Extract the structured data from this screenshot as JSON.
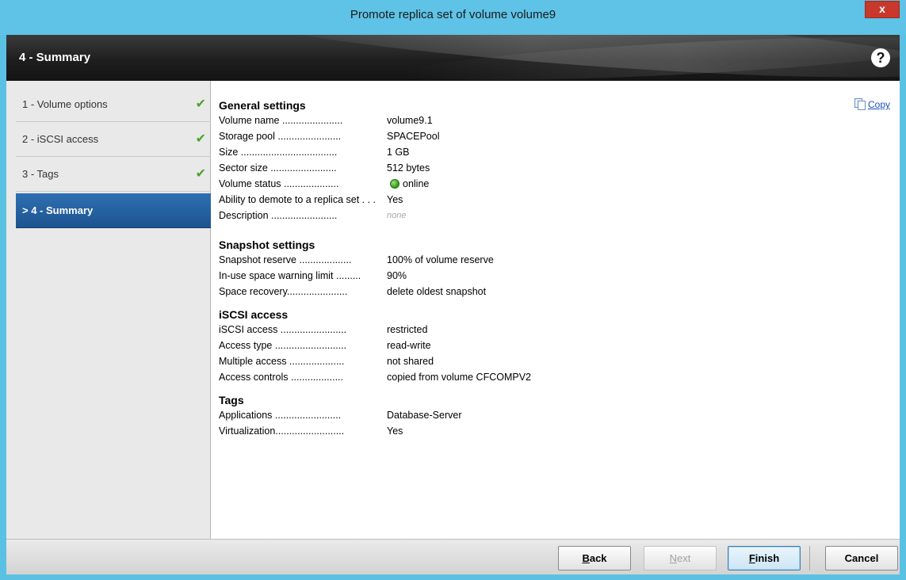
{
  "window": {
    "title": "Promote replica set of volume volume9",
    "close_label": "x"
  },
  "header": {
    "title": "4 - Summary",
    "help_label": "?"
  },
  "nav": {
    "items": [
      {
        "label": "1 - Volume options",
        "done": true
      },
      {
        "label": "2 - iSCSI access",
        "done": true
      },
      {
        "label": "3 - Tags",
        "done": true
      },
      {
        "label": "> 4 - Summary",
        "done": false
      }
    ],
    "check_glyph": "✔"
  },
  "content": {
    "copy_label": "Copy",
    "general": {
      "title": "General settings",
      "rows": [
        {
          "label": "Volume name ......................",
          "value": "volume9.1"
        },
        {
          "label": "Storage pool .......................",
          "value": "SPACEPool"
        },
        {
          "label": "Size ...................................",
          "value": "1 GB"
        },
        {
          "label": "Sector size ........................",
          "value": "512 bytes"
        },
        {
          "label": "Volume status ....................",
          "value": "online"
        },
        {
          "label": "Ability to demote to a replica set . . .",
          "value": "Yes"
        },
        {
          "label": "Description ........................",
          "value": "none"
        }
      ]
    },
    "snapshot": {
      "title": "Snapshot settings",
      "rows": [
        {
          "label": "Snapshot reserve ...................",
          "value": "100% of volume reserve"
        },
        {
          "label": "In-use space warning limit .........",
          "value": "90%"
        },
        {
          "label": "Space recovery......................",
          "value": "delete oldest snapshot"
        }
      ]
    },
    "iscsi": {
      "title": "iSCSI access",
      "rows": [
        {
          "label": "iSCSI access ........................",
          "value": "restricted"
        },
        {
          "label": "Access type ..........................",
          "value": "read-write"
        },
        {
          "label": "Multiple access ....................",
          "value": "not shared"
        },
        {
          "label": "Access controls ...................",
          "value": "copied from volume CFCOMPV2"
        }
      ]
    },
    "tags": {
      "title": "Tags",
      "rows": [
        {
          "label": "Applications ........................",
          "value": "Database-Server"
        },
        {
          "label": "Virtualization.........................",
          "value": "Yes"
        }
      ]
    }
  },
  "footer": {
    "back": {
      "label": "Back",
      "mnemonic": "B",
      "rest": "ack"
    },
    "next": {
      "label": "Next",
      "mnemonic": "N",
      "rest": "ext"
    },
    "finish": {
      "label": "Finish",
      "mnemonic": "F",
      "rest": "inish"
    },
    "cancel": {
      "label": "Cancel"
    }
  },
  "colors": {
    "titlebar": "#5ec3e6",
    "active_nav": "#1c548f",
    "check": "#4aa32a",
    "status_online": "#2e9b14",
    "link": "#1a4fc4"
  }
}
